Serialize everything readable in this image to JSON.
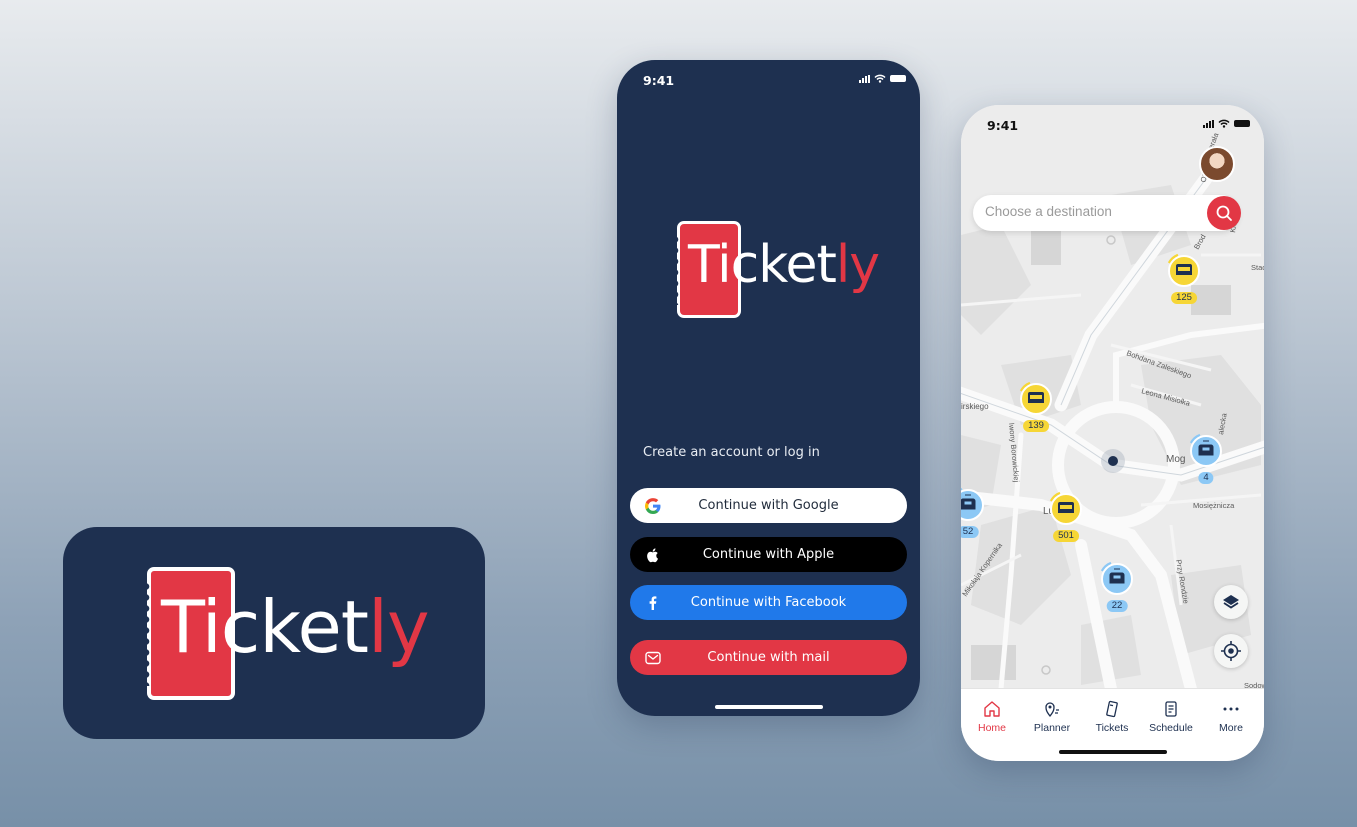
{
  "brand": {
    "name_main": "Ticket",
    "name_accent": "ly",
    "colors": {
      "navy": "#1e3050",
      "red": "#e23745",
      "facebook": "#2079ea",
      "bus_yellow": "#f6d636",
      "tram_blue": "#8cc8f5"
    }
  },
  "login_screen": {
    "status_time": "9:41",
    "prompt": "Create an account or log in",
    "buttons": {
      "google": "Continue with Google",
      "apple": "Continue with Apple",
      "facebook": "Continue with Facebook",
      "mail": "Continue with mail"
    },
    "icons": [
      "google-icon",
      "apple-icon",
      "facebook-icon",
      "mail-icon"
    ]
  },
  "map_screen": {
    "status_time": "9:41",
    "search": {
      "placeholder": "Choose a destination"
    },
    "street_labels": [
      "Bohdana Zaleskiego",
      "Leona Misiołka",
      "Mosiężnicza",
      "Przy Rondzie",
      "Mog",
      "Lub",
      "Iwony Borowickiej",
      "Mikołaja Kopernika",
      "irskiego",
      "Brod",
      "Stac",
      "Generała",
      "Olsz",
      "Kle",
      "Sodow",
      "alecka"
    ],
    "vehicles": [
      {
        "type": "bus",
        "line": "125"
      },
      {
        "type": "bus",
        "line": "139"
      },
      {
        "type": "tram",
        "line": "4"
      },
      {
        "type": "tram",
        "line": "52"
      },
      {
        "type": "bus",
        "line": "501"
      },
      {
        "type": "tram",
        "line": "22"
      }
    ],
    "tabs": [
      {
        "label": "Home",
        "icon": "home-icon",
        "active": true
      },
      {
        "label": "Planner",
        "icon": "planner-pin-icon",
        "active": false
      },
      {
        "label": "Tickets",
        "icon": "tickets-icon",
        "active": false
      },
      {
        "label": "Schedule",
        "icon": "schedule-icon",
        "active": false
      },
      {
        "label": "More",
        "icon": "more-dots-icon",
        "active": false
      }
    ]
  }
}
